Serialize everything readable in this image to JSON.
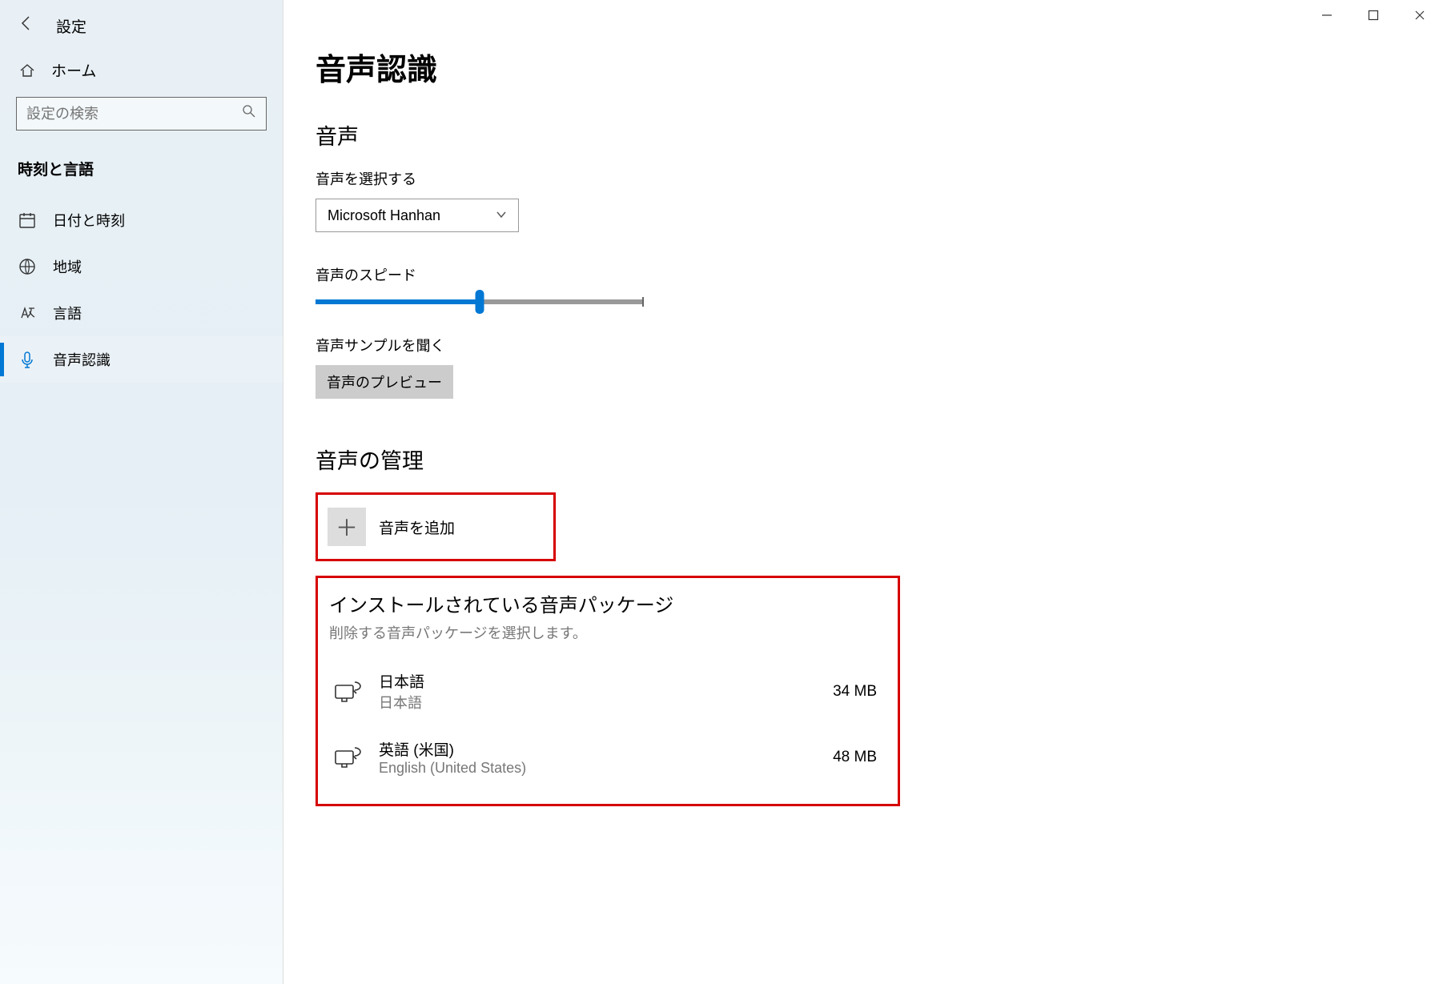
{
  "window": {
    "app_title": "設定"
  },
  "sidebar": {
    "home": "ホーム",
    "search_placeholder": "設定の検索",
    "section": "時刻と言語",
    "items": [
      {
        "label": "日付と時刻"
      },
      {
        "label": "地域"
      },
      {
        "label": "言語"
      },
      {
        "label": "音声認識"
      }
    ]
  },
  "main": {
    "title": "音声認識",
    "voice_section": "音声",
    "select_label": "音声を選択する",
    "voice_selected": "Microsoft Hanhan",
    "speed_label": "音声のスピード",
    "speed_percent": 50,
    "sample_label": "音声サンプルを聞く",
    "preview_btn": "音声のプレビュー",
    "manage_section": "音声の管理",
    "add_voice": "音声を追加",
    "packages_title": "インストールされている音声パッケージ",
    "packages_sub": "削除する音声パッケージを選択します。",
    "packages": [
      {
        "name": "日本語",
        "desc": "日本語",
        "size": "34 MB"
      },
      {
        "name": "英語 (米国)",
        "desc": "English (United States)",
        "size": "48 MB"
      }
    ]
  }
}
